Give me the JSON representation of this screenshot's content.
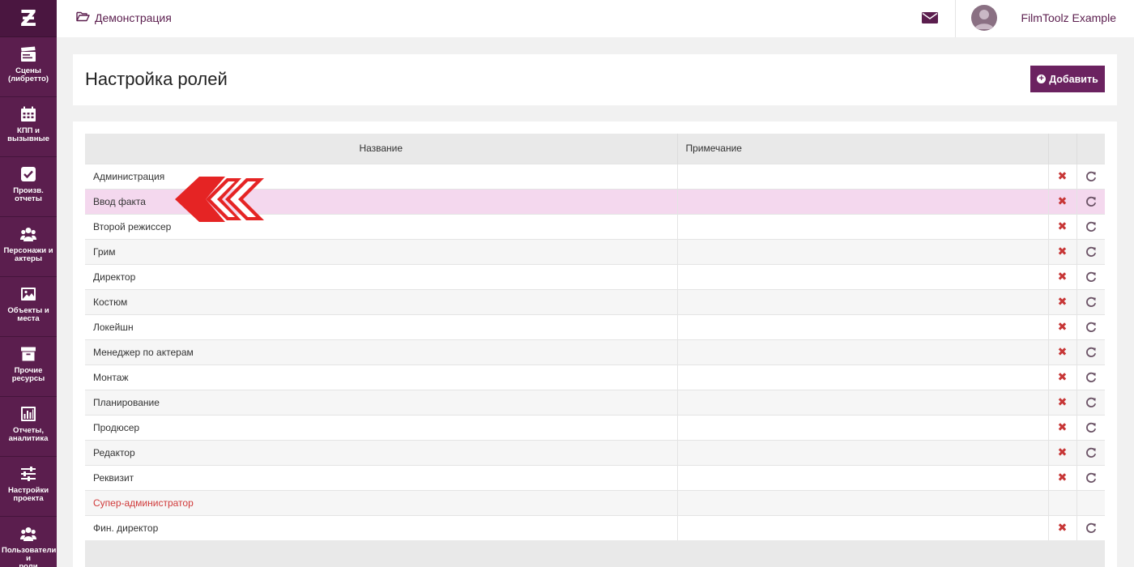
{
  "brand": {
    "logo_icon": "filmtoolz-z-logo"
  },
  "sidebar": {
    "items": [
      {
        "label": "Сцены\n(либретто)",
        "icon": "clapperboard-icon"
      },
      {
        "label": "КПП и\nвызывные",
        "icon": "calendar-icon"
      },
      {
        "label": "Произв.\nотчеты",
        "icon": "checkbox-icon"
      },
      {
        "label": "Персонажи и\nактеры",
        "icon": "users-icon"
      },
      {
        "label": "Объекты и\nместа",
        "icon": "image-icon"
      },
      {
        "label": "Прочие\nресурсы",
        "icon": "archive-icon"
      },
      {
        "label": "Отчеты,\nаналитика",
        "icon": "bar-chart-icon"
      },
      {
        "label": "Настройки\nпроекта",
        "icon": "sliders-icon"
      },
      {
        "label": "Пользователи и\nроли",
        "icon": "users-icon"
      }
    ]
  },
  "topbar": {
    "breadcrumb": "Демонстрация",
    "breadcrumb_icon": "folder-open-icon",
    "mail_icon": "envelope-icon",
    "user_name": "FilmToolz Example"
  },
  "page": {
    "title": "Настройка ролей",
    "add_button": "Добавить"
  },
  "table": {
    "columns": [
      "Название",
      "Примечание"
    ],
    "rows": [
      {
        "name": "Администрация",
        "note": "",
        "actions": true
      },
      {
        "name": "Ввод факта",
        "note": "",
        "actions": true,
        "highlighted": true
      },
      {
        "name": "Второй режиссер",
        "note": "",
        "actions": true
      },
      {
        "name": "Грим",
        "note": "",
        "actions": true
      },
      {
        "name": "Директор",
        "note": "",
        "actions": true
      },
      {
        "name": "Костюм",
        "note": "",
        "actions": true
      },
      {
        "name": "Локейшн",
        "note": "",
        "actions": true
      },
      {
        "name": "Менеджер по актерам",
        "note": "",
        "actions": true
      },
      {
        "name": "Монтаж",
        "note": "",
        "actions": true
      },
      {
        "name": "Планирование",
        "note": "",
        "actions": true
      },
      {
        "name": "Продюсер",
        "note": "",
        "actions": true
      },
      {
        "name": "Редактор",
        "note": "",
        "actions": true
      },
      {
        "name": "Реквизит",
        "note": "",
        "actions": true
      },
      {
        "name": "Супер-администратор",
        "note": "",
        "actions": false,
        "system": true
      },
      {
        "name": "Фин. директор",
        "note": "",
        "actions": true
      }
    ],
    "delete_icon": "close-icon",
    "reset_icon": "refresh-icon"
  },
  "colors": {
    "sidebar": "#5b1e4e",
    "accent": "#6b2260",
    "highlight_row": "#f4d8ee",
    "delete": "#c73636",
    "annotation_arrow": "#e52424"
  }
}
